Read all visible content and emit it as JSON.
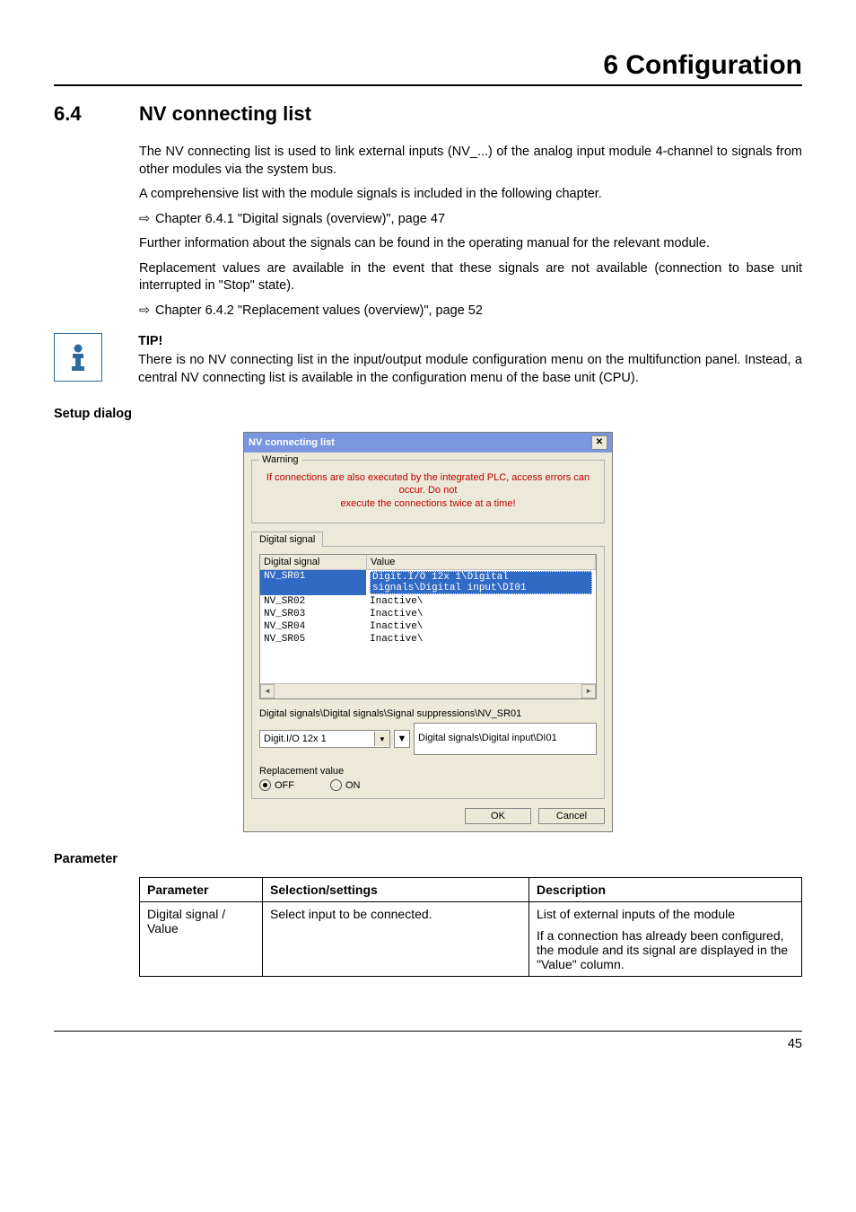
{
  "chapter_title": "6 Configuration",
  "section": {
    "number": "6.4",
    "title": "NV connecting list"
  },
  "paragraphs": {
    "p1": "The NV connecting list is used to link external inputs (NV_...) of the analog input module 4-channel to signals from other modules via the system bus.",
    "p2": "A comprehensive list with the module signals is included in the following chapter.",
    "link1": "Chapter 6.4.1 \"Digital signals (overview)\", page 47",
    "p3": "Further information about the signals can be found in the operating manual for the relevant module.",
    "p4": "Replacement values are available in the event that these signals are not available (connection to base unit interrupted in \"Stop\" state).",
    "link2": "Chapter 6.4.2 \"Replacement values (overview)\", page 52"
  },
  "tip": {
    "label": "TIP!",
    "text": "There is no NV connecting list in the input/output module configuration menu on the multifunction panel. Instead, a central NV connecting list is available in the configuration menu of the base unit (CPU)."
  },
  "subheads": {
    "setup": "Setup dialog",
    "parameter": "Parameter"
  },
  "dialog": {
    "title": "NV connecting list",
    "warning_legend": "Warning",
    "warning_text1": "If connections are also executed by the integrated PLC, access errors can occur. Do not",
    "warning_text2": "execute the connections twice at a time!",
    "tab": "Digital signal",
    "col1": "Digital signal",
    "col2": "Value",
    "rows": [
      {
        "name": "NV_SR01",
        "value": "Digit.I/O 12x 1\\Digital signals\\Digital input\\DI01",
        "selected": true
      },
      {
        "name": "NV_SR02",
        "value": "Inactive\\",
        "selected": false
      },
      {
        "name": "NV_SR03",
        "value": "Inactive\\",
        "selected": false
      },
      {
        "name": "NV_SR04",
        "value": "Inactive\\",
        "selected": false
      },
      {
        "name": "NV_SR05",
        "value": "Inactive\\",
        "selected": false
      }
    ],
    "path_label": "Digital signals\\Digital signals\\Signal suppressions\\NV_SR01",
    "combo_left": "Digit.I/O 12x 1",
    "combo_right": "Digital signals\\Digital input\\DI01",
    "replacement_label": "Replacement value",
    "radio_off": "OFF",
    "radio_on": "ON",
    "ok": "OK",
    "cancel": "Cancel"
  },
  "param_table": {
    "h1": "Parameter",
    "h2": "Selection/settings",
    "h3": "Description",
    "r1c1": "Digital signal / Value",
    "r1c2": "Select input to be connected.",
    "r1c3a": "List of external inputs of the module",
    "r1c3b": "If a connection has already been configured, the module and its signal are displayed in the \"Value\" column."
  },
  "page_number": "45"
}
